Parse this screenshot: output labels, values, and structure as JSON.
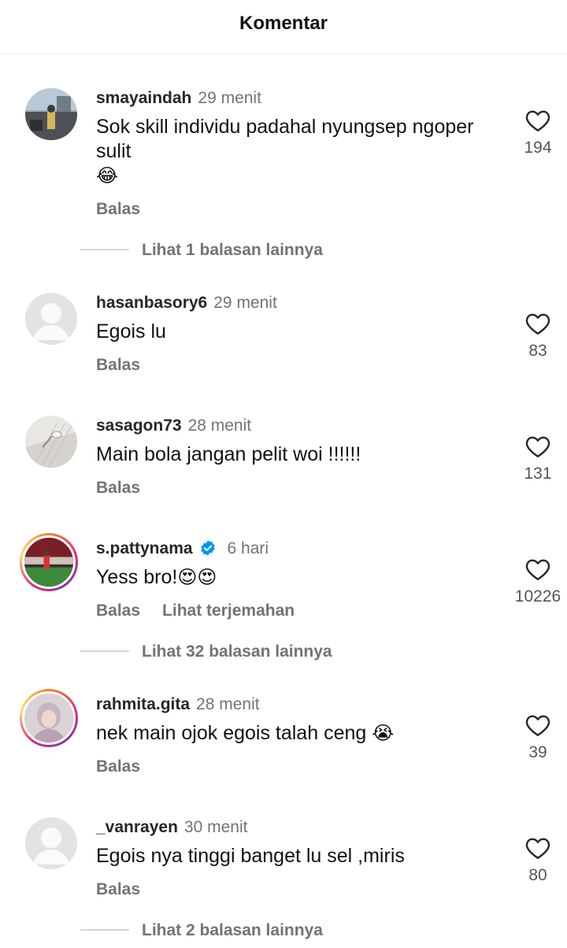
{
  "header": {
    "title": "Komentar"
  },
  "comments": [
    {
      "username": "smayaindah",
      "time": "29 menit",
      "text": "Sok skill individu padahal nyungsep ngoper sulit",
      "emoji": "😂",
      "reply": "Balas",
      "likes": "194",
      "more_replies": "Lihat 1 balasan lainnya",
      "avatar": "photo-outdoor"
    },
    {
      "username": "hasanbasory6",
      "time": "29 menit",
      "text": "Egois lu",
      "reply": "Balas",
      "likes": "83",
      "avatar": "default-avatar"
    },
    {
      "username": "sasagon73",
      "time": "28 menit",
      "text": "Main bola jangan pelit woi !!!!!!",
      "reply": "Balas",
      "likes": "131",
      "avatar": "photo-tiles"
    },
    {
      "username": "s.pattynama",
      "time": "6 hari",
      "verified": true,
      "text": "Yess bro!",
      "emoji": "😍😍",
      "reply": "Balas",
      "translate": "Lihat terjemahan",
      "likes": "10226",
      "more_replies": "Lihat 32 balasan lainnya",
      "avatar": "photo-stadium",
      "story_ring": true
    },
    {
      "username": "rahmita.gita",
      "time": "28 menit",
      "text": "nek main ojok egois talah ceng",
      "emoji": "😭",
      "reply": "Balas",
      "likes": "39",
      "avatar": "photo-portrait",
      "story_ring": true
    },
    {
      "username": "_vanrayen",
      "time": "30 menit",
      "text": "Egois nya tinggi banget lu sel ,miris",
      "reply": "Balas",
      "likes": "80",
      "more_replies": "Lihat 2 balasan lainnya",
      "avatar": "default-avatar"
    }
  ],
  "colors": {
    "text": "#262626",
    "muted": "#737373",
    "verified": "#0095f6"
  }
}
